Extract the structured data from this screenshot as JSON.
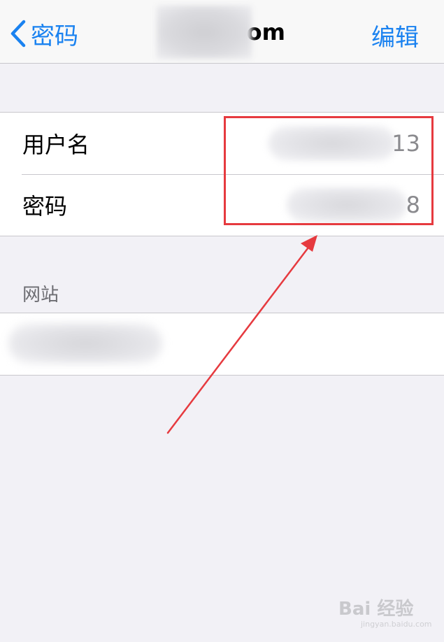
{
  "navbar": {
    "back_label": "密码",
    "title_suffix": "om",
    "edit_label": "编辑"
  },
  "credentials": {
    "username_label": "用户名",
    "username_value_tail": "13",
    "password_label": "密码",
    "password_value_tail": "8"
  },
  "website_section": {
    "header": "网站"
  },
  "watermark": {
    "brand": "Bai 经验",
    "domain": "jingyan.baidu.com"
  },
  "colors": {
    "accent": "#1a82f0",
    "highlight": "#e63a3f",
    "background": "#f2f1f6"
  }
}
